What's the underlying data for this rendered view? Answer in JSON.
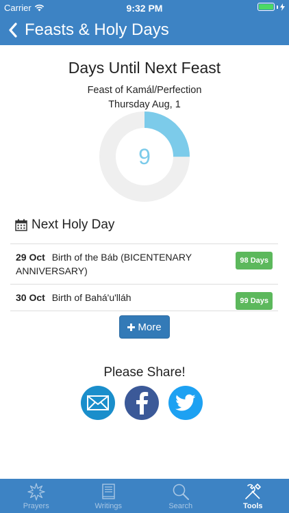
{
  "status_bar": {
    "carrier": "Carrier",
    "time": "9:32 PM"
  },
  "nav": {
    "title": "Feasts & Holy Days"
  },
  "next_feast": {
    "heading": "Days Until Next Feast",
    "name": "Feast of Kamál/Perfection",
    "date": "Thursday Aug, 1",
    "days": "9",
    "progress_fraction": 0.25,
    "ring_color": "#7ccbea",
    "track_color": "#efefef"
  },
  "holy": {
    "heading": "Next Holy Day",
    "items": [
      {
        "date": "29 Oct",
        "name": "Birth of the Báb (BICENTENARY ANNIVERSARY)",
        "badge": "98 Days"
      },
      {
        "date": "30 Oct",
        "name": "Birth of Bahá'u'lláh",
        "badge": "99 Days"
      }
    ],
    "more_label": "More"
  },
  "share": {
    "title": "Please Share!",
    "colors": {
      "email": "#1a8ecb",
      "facebook": "#3b5998",
      "twitter": "#1da1f2"
    }
  },
  "tabs": [
    {
      "label": "Prayers",
      "icon": "star-burst-icon"
    },
    {
      "label": "Writings",
      "icon": "book-icon"
    },
    {
      "label": "Search",
      "icon": "search-icon"
    },
    {
      "label": "Tools",
      "icon": "tools-icon",
      "active": true
    }
  ]
}
